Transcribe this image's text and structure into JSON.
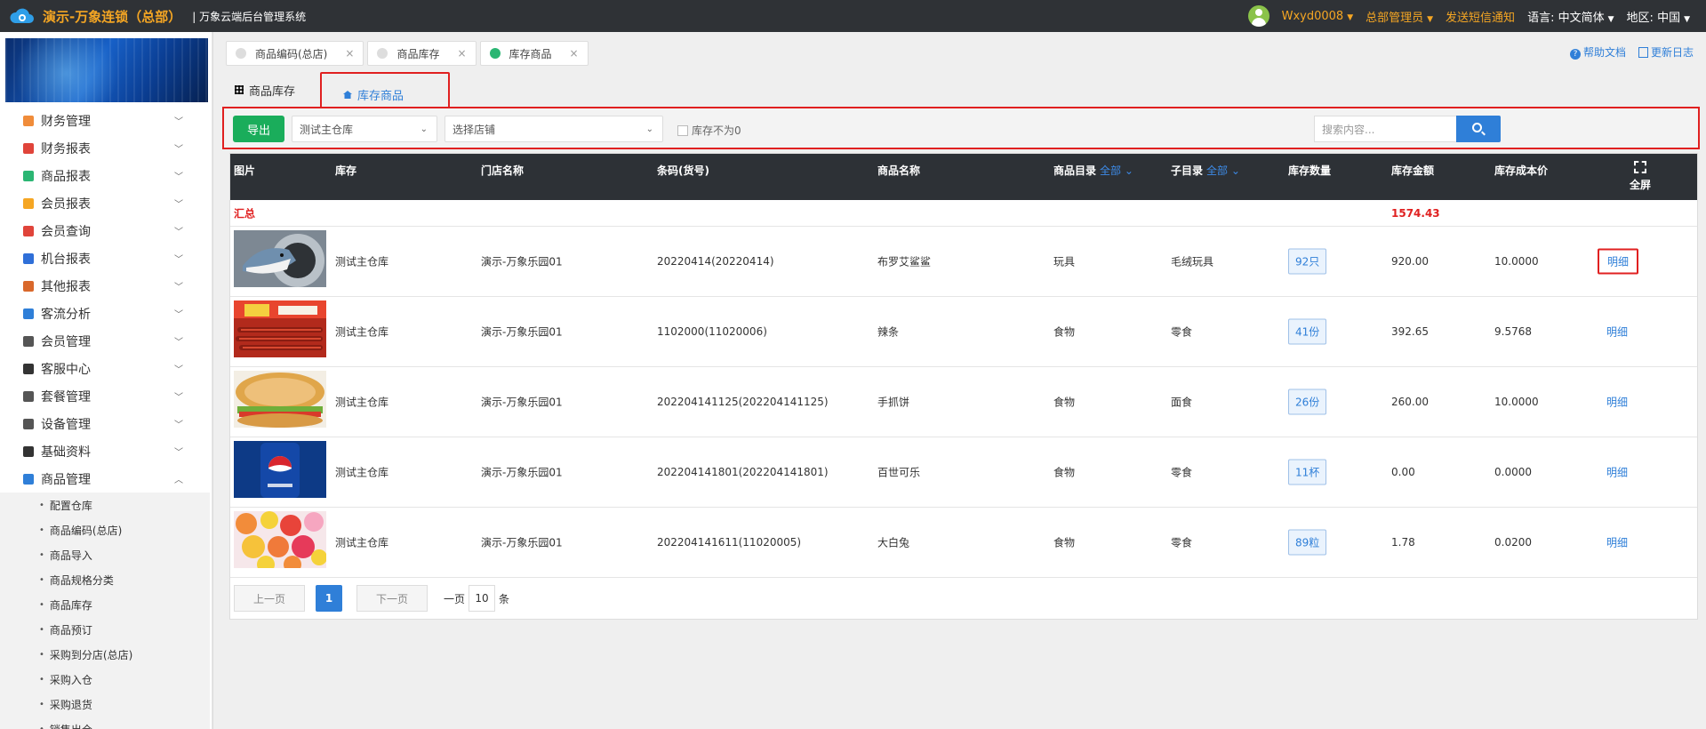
{
  "header": {
    "brand": "演示-万象连锁（总部）",
    "system_name": "| 万象云端后台管理系统",
    "username": "Wxyd0008",
    "role": "总部管理员",
    "sms": "发送短信通知",
    "lang_label": "语言:",
    "lang_value": "中文简体",
    "region_label": "地区:",
    "region_value": "中国"
  },
  "sidebar": {
    "items": [
      {
        "label": "财务管理",
        "color": "#f08c3a"
      },
      {
        "label": "财务报表",
        "color": "#e0443a"
      },
      {
        "label": "商品报表",
        "color": "#2bb673"
      },
      {
        "label": "会员报表",
        "color": "#f5a623"
      },
      {
        "label": "会员查询",
        "color": "#e0443a"
      },
      {
        "label": "机台报表",
        "color": "#2f6fd8"
      },
      {
        "label": "其他报表",
        "color": "#d9682b"
      },
      {
        "label": "客流分析",
        "color": "#2f7fd8"
      },
      {
        "label": "会员管理",
        "color": "#555555"
      },
      {
        "label": "客服中心",
        "color": "#333333"
      },
      {
        "label": "套餐管理",
        "color": "#555555"
      },
      {
        "label": "设备管理",
        "color": "#555555"
      },
      {
        "label": "基础资料",
        "color": "#333333"
      },
      {
        "label": "商品管理",
        "color": "#2f7fd8"
      }
    ],
    "subitems": [
      "配置仓库",
      "商品编码(总店)",
      "商品导入",
      "商品规格分类",
      "商品库存",
      "商品预订",
      "采购到分店(总店)",
      "采购入仓",
      "采购退货",
      "销售出仓"
    ]
  },
  "tabs": [
    {
      "label": "商品编码(总店)",
      "active": false
    },
    {
      "label": "商品库存",
      "active": false
    },
    {
      "label": "库存商品",
      "active": true
    }
  ],
  "help": {
    "doc": "帮助文档",
    "log": "更新日志"
  },
  "subtabs": {
    "main": "商品库存",
    "active": "库存商品"
  },
  "toolbar": {
    "export": "导出",
    "warehouse_value": "测试主仓库",
    "store_placeholder": "选择店铺",
    "nonzero_label": "库存不为0",
    "search_placeholder": "搜索内容..."
  },
  "table": {
    "headers": {
      "image": "图片",
      "stock": "库存",
      "store": "门店名称",
      "barcode": "条码(货号)",
      "name": "商品名称",
      "category": "商品目录",
      "subcategory": "子目录",
      "all": "全部",
      "qty": "库存数量",
      "amount": "库存金额",
      "cost": "库存成本价",
      "fullscreen": "全屏"
    },
    "summary": {
      "label": "汇总",
      "amount": "1574.43"
    },
    "detail_label": "明细",
    "rows": [
      {
        "stock": "测试主仓库",
        "store": "演示-万象乐园01",
        "barcode": "20220414(20220414)",
        "name": "布罗艾鲨鲨",
        "category": "玩具",
        "subcategory": "毛绒玩具",
        "qty": "92只",
        "amount": "920.00",
        "cost": "10.0000"
      },
      {
        "stock": "测试主仓库",
        "store": "演示-万象乐园01",
        "barcode": "1102000(11020006)",
        "name": "辣条",
        "category": "食物",
        "subcategory": "零食",
        "qty": "41份",
        "amount": "392.65",
        "cost": "9.5768"
      },
      {
        "stock": "测试主仓库",
        "store": "演示-万象乐园01",
        "barcode": "202204141125(202204141125)",
        "name": "手抓饼",
        "category": "食物",
        "subcategory": "面食",
        "qty": "26份",
        "amount": "260.00",
        "cost": "10.0000"
      },
      {
        "stock": "测试主仓库",
        "store": "演示-万象乐园01",
        "barcode": "202204141801(202204141801)",
        "name": "百世可乐",
        "category": "食物",
        "subcategory": "零食",
        "qty": "11杯",
        "amount": "0.00",
        "cost": "0.0000"
      },
      {
        "stock": "测试主仓库",
        "store": "演示-万象乐园01",
        "barcode": "202204141611(11020005)",
        "name": "大白兔",
        "category": "食物",
        "subcategory": "零食",
        "qty": "89粒",
        "amount": "1.78",
        "cost": "0.0200"
      }
    ]
  },
  "pager": {
    "prev": "上一页",
    "current": "1",
    "next": "下一页",
    "per_page_prefix": "一页",
    "per_page": "10",
    "per_page_suffix": "条"
  }
}
